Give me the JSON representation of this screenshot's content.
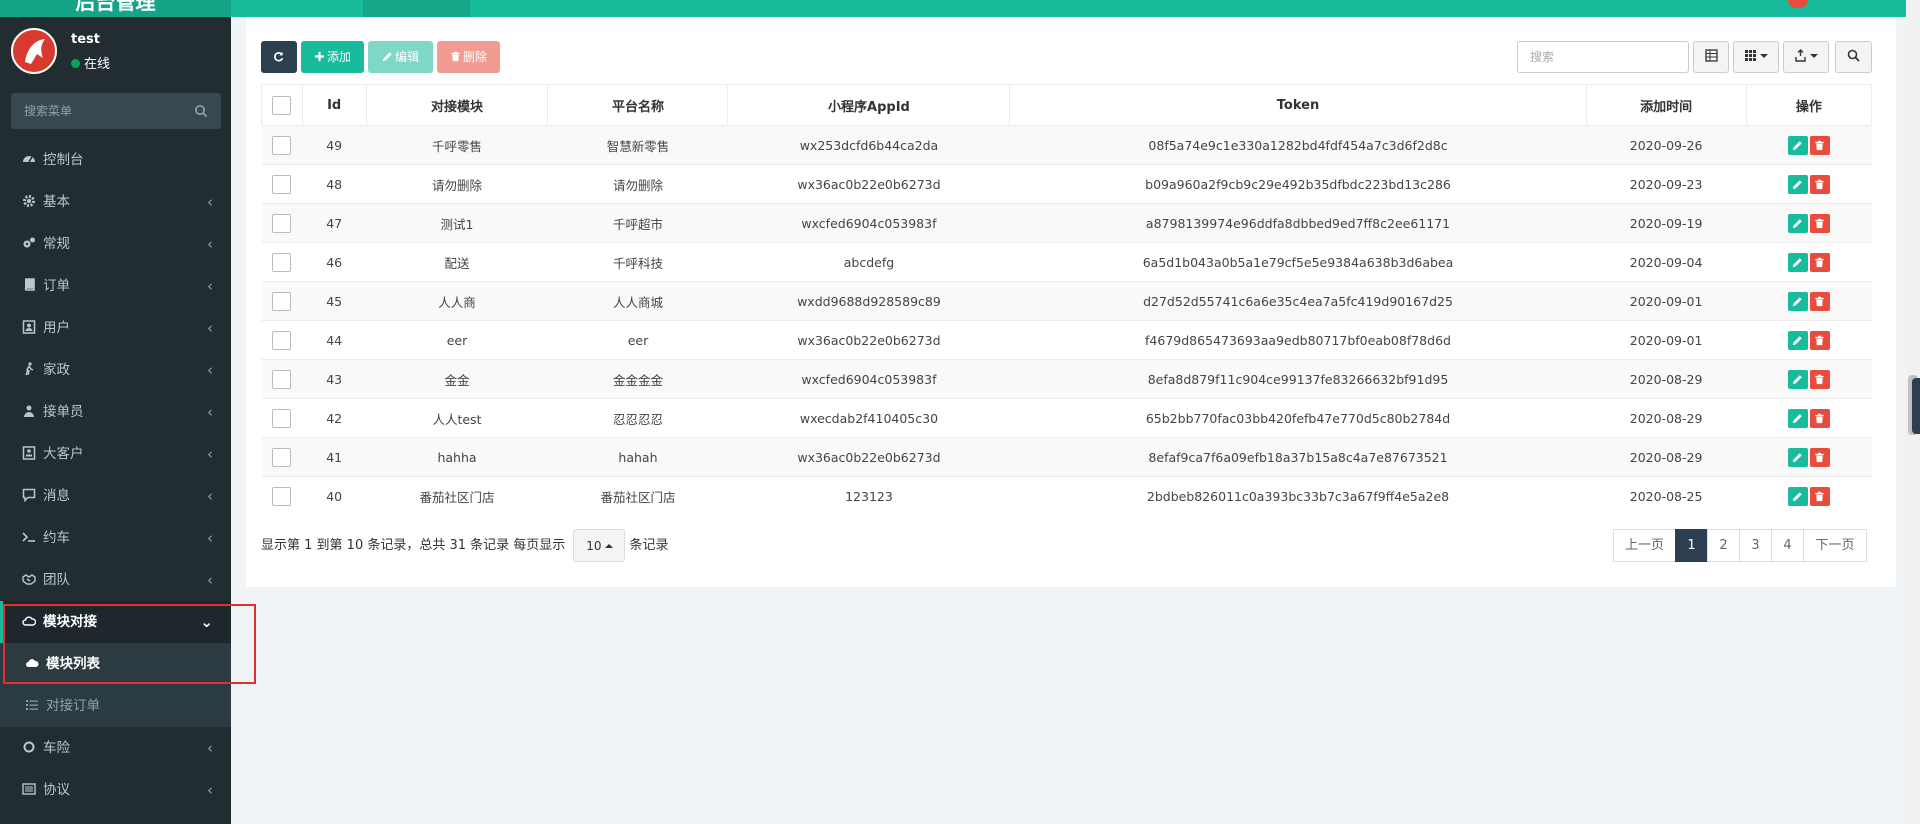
{
  "header": {
    "logo_text": "后台管理"
  },
  "user": {
    "name": "test",
    "status": "在线"
  },
  "menu_search": {
    "placeholder": "搜索菜单"
  },
  "sidebar": {
    "items": [
      {
        "label": "控制台",
        "icon": "dashboard-icon"
      },
      {
        "label": "基本",
        "icon": "gear-icon"
      },
      {
        "label": "常规",
        "icon": "gears-icon"
      },
      {
        "label": "订单",
        "icon": "book-icon"
      },
      {
        "label": "用户",
        "icon": "user-card-icon"
      },
      {
        "label": "家政",
        "icon": "person-walking-icon"
      },
      {
        "label": "接单员",
        "icon": "users-icon"
      },
      {
        "label": "大客户",
        "icon": "id-card-icon"
      },
      {
        "label": "消息",
        "icon": "chat-icon"
      },
      {
        "label": "约车",
        "icon": "terminal-icon"
      },
      {
        "label": "团队",
        "icon": "handshake-icon"
      }
    ],
    "active_group": {
      "label": "模块对接",
      "icon": "cloud-outline-icon"
    },
    "sub_items": [
      {
        "label": "模块列表",
        "icon": "cloud-icon"
      },
      {
        "label": "对接订单",
        "icon": "list-icon"
      }
    ],
    "after_items": [
      {
        "label": "车险",
        "icon": "circle-icon"
      },
      {
        "label": "协议",
        "icon": "list-alt-icon"
      }
    ]
  },
  "toolbar": {
    "add_label": "添加",
    "edit_label": "编辑",
    "delete_label": "删除",
    "search_placeholder": "搜索"
  },
  "table": {
    "columns": [
      "Id",
      "对接模块",
      "平台名称",
      "小程序AppId",
      "Token",
      "添加时间",
      "操作"
    ],
    "rows": [
      {
        "id": "49",
        "module": "千呼零售",
        "platform": "智慧新零售",
        "appid": "wx253dcfd6b44ca2da",
        "token": "08f5a74e9c1e330a1282bd4fdf454a7c3d6f2d8c",
        "date": "2020-09-26"
      },
      {
        "id": "48",
        "module": "请勿删除",
        "platform": "请勿删除",
        "appid": "wx36ac0b22e0b6273d",
        "token": "b09a960a2f9cb9c29e492b35dfbdc223bd13c286",
        "date": "2020-09-23"
      },
      {
        "id": "47",
        "module": "测试1",
        "platform": "千呼超市",
        "appid": "wxcfed6904c053983f",
        "token": "a8798139974e96ddfa8dbbed9ed7ff8c2ee61171",
        "date": "2020-09-19"
      },
      {
        "id": "46",
        "module": "配送",
        "platform": "千呼科技",
        "appid": "abcdefg",
        "token": "6a5d1b043a0b5a1e79cf5e5e9384a638b3d6abea",
        "date": "2020-09-04"
      },
      {
        "id": "45",
        "module": "人人商",
        "platform": "人人商城",
        "appid": "wxdd9688d928589c89",
        "token": "d27d52d55741c6a6e35c4ea7a5fc419d90167d25",
        "date": "2020-09-01"
      },
      {
        "id": "44",
        "module": "eer",
        "platform": "eer",
        "appid": "wx36ac0b22e0b6273d",
        "token": "f4679d865473693aa9edb80717bf0eab08f78d6d",
        "date": "2020-09-01"
      },
      {
        "id": "43",
        "module": "金金",
        "platform": "金金金金",
        "appid": "wxcfed6904c053983f",
        "token": "8efa8d879f11c904ce99137fe83266632bf91d95",
        "date": "2020-08-29"
      },
      {
        "id": "42",
        "module": "人人test",
        "platform": "忍忍忍忍",
        "appid": "wxecdab2f410405c30",
        "token": "65b2bb770fac03bb420fefb47e770d5c80b2784d",
        "date": "2020-08-29"
      },
      {
        "id": "41",
        "module": "hahha",
        "platform": "hahah",
        "appid": "wx36ac0b22e0b6273d",
        "token": "8efaf9ca7f6a09efb18a37b15a8c4a7e87673521",
        "date": "2020-08-29"
      },
      {
        "id": "40",
        "module": "番茄社区门店",
        "platform": "番茄社区门店",
        "appid": "123123",
        "token": "2bdbeb826011c0a393bc33b7c3a67f9ff4e5a2e8",
        "date": "2020-08-25"
      }
    ]
  },
  "footer": {
    "info_prefix": "显示第 1 到第 10 条记录，总共 31 条记录 每页显示",
    "page_size": "10",
    "info_suffix": "条记录"
  },
  "pagination": {
    "prev": "上一页",
    "pages": [
      "1",
      "2",
      "3",
      "4"
    ],
    "current": "1",
    "next": "下一页"
  },
  "colors": {
    "accent": "#18bc9c",
    "sidebar": "#222d32",
    "danger": "#e74c3c",
    "primary": "#2c3e50"
  }
}
